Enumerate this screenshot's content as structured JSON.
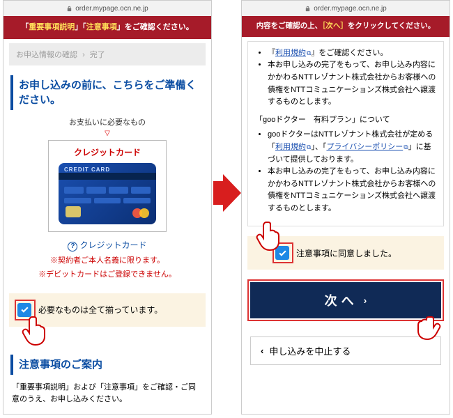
{
  "addressbar": {
    "host": "order.mypage.ocn.ne.jp"
  },
  "left": {
    "banner_pre": "「",
    "banner_y1": "重要事項説明",
    "banner_mid": "」「",
    "banner_y2": "注意事項",
    "banner_post": "」をご確認ください。",
    "crumb_step1": "お申込情報の確認",
    "crumb_step2": "完了",
    "heading": "お申し込みの前に、こちらをご準備ください。",
    "pay_label": "お支払いに必要なもの",
    "card_title": "クレジットカード",
    "cc_text": "CREDIT CARD",
    "help_label": "クレジットカード",
    "warn1": "※契約者ご本人名義に限ります。",
    "warn2": "※デビットカードはご登録できません。",
    "checkbox_label": "必要なものは全て揃っています。",
    "notes_heading": "注意事項のご案内",
    "notes_body": "「重要事項説明」および「注意事項」をご確認・ご同意のうえ、お申し込みください。"
  },
  "right": {
    "banner_pre": "内容をご確認の上、",
    "banner_y": "［次へ］",
    "banner_post": "をクリックしてください。",
    "b1_pre": "『",
    "b1_link": "利用規約",
    "b1_post": "』をご確認ください。",
    "b2": "本お申し込みの完了をもって、お申し込み内容にかかわるNTTレゾナント株式会社からお客様への債権をNTTコミュニケーションズ株式会社へ譲渡するものとします。",
    "mid": "「gooドクター　有料プラン」について",
    "b3_pre": "gooドクターはNTTレゾナント株式会社が定める「",
    "b3_link1": "利用規約",
    "b3_mid": "」、「",
    "b3_link2": "プライバシーポリシー",
    "b3_post": "」に基づいて提供しております。",
    "b4": "本お申し込みの完了をもって、お申し込み内容にかかわるNTTレゾナント株式会社からお客様への債権をNTTコミュニケーションズ株式会社へ譲渡するものとします。",
    "agree_label": "注意事項に同意しました。",
    "next_label": "次へ",
    "cancel_label": "申し込みを中止する"
  }
}
